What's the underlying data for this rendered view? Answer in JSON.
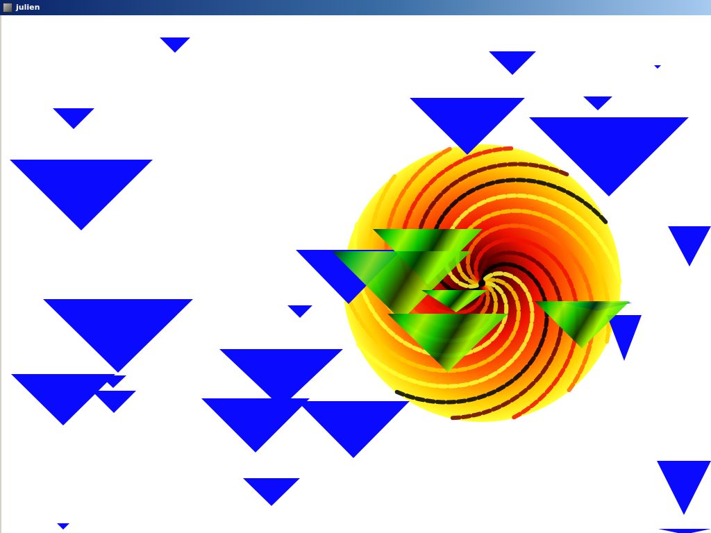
{
  "window": {
    "title": "julien",
    "icon": "app-window-icon"
  },
  "scene": {
    "background": "#ffffff",
    "shape_color": "#0a0aff",
    "fractal_palette": [
      "#ffff33",
      "#ffcc00",
      "#ff6600",
      "#ee1100",
      "#660000",
      "#000000"
    ],
    "overlay_palette": [
      "#00cc00",
      "#99ff00",
      "#003300"
    ]
  }
}
